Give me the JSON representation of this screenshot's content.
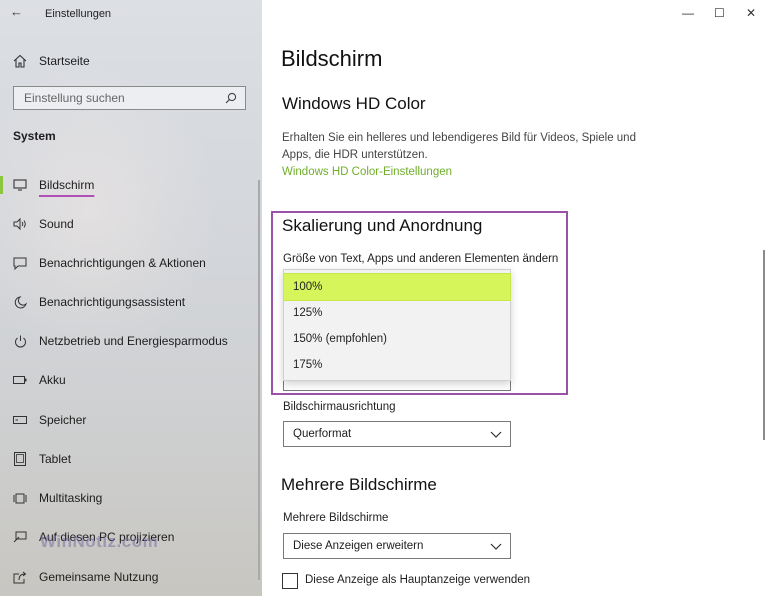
{
  "window": {
    "title": "Einstellungen",
    "back_glyph": "←",
    "controls": {
      "minimize": "—",
      "maximize": "☐",
      "close": "✕"
    }
  },
  "sidebar": {
    "home_label": "Startseite",
    "search_placeholder": "Einstellung suchen",
    "section": "System",
    "active_accent": "#8cc63f",
    "items": [
      {
        "label": "Bildschirm",
        "icon": "monitor-icon",
        "active": true
      },
      {
        "label": "Sound",
        "icon": "speaker-icon"
      },
      {
        "label": "Benachrichtigungen & Aktionen",
        "icon": "message-icon"
      },
      {
        "label": "Benachrichtigungsassistent",
        "icon": "moon-icon"
      },
      {
        "label": "Netzbetrieb und Energiesparmodus",
        "icon": "power-icon"
      },
      {
        "label": "Akku",
        "icon": "battery-icon"
      },
      {
        "label": "Speicher",
        "icon": "storage-icon"
      },
      {
        "label": "Tablet",
        "icon": "tablet-icon"
      },
      {
        "label": "Multitasking",
        "icon": "multitasking-icon"
      },
      {
        "label": "Auf diesen PC projizieren",
        "icon": "project-icon"
      },
      {
        "label": "Gemeinsame Nutzung",
        "icon": "share-icon"
      }
    ],
    "watermark": "WinNotiz.com"
  },
  "main": {
    "title": "Bildschirm",
    "hd_color": {
      "heading": "Windows HD Color",
      "description": "Erhalten Sie ein helleres und lebendigeres Bild für Videos, Spiele und Apps, die HDR unterstützen.",
      "link": "Windows HD Color-Einstellungen"
    },
    "scale": {
      "heading": "Skalierung und Anordnung",
      "size_label": "Größe von Text, Apps und anderen Elementen ändern",
      "options": [
        "100%",
        "125%",
        "150% (empfohlen)",
        "175%"
      ],
      "selected": "100%",
      "highlight_color": "#d6f55b",
      "box_color": "#9a52a8"
    },
    "orientation": {
      "label": "Bildschirmausrichtung",
      "value": "Querformat"
    },
    "multi": {
      "heading": "Mehrere Bildschirme",
      "label": "Mehrere Bildschirme",
      "value": "Diese Anzeigen erweitern",
      "checkbox_label": "Diese Anzeige als Hauptanzeige verwenden"
    }
  }
}
